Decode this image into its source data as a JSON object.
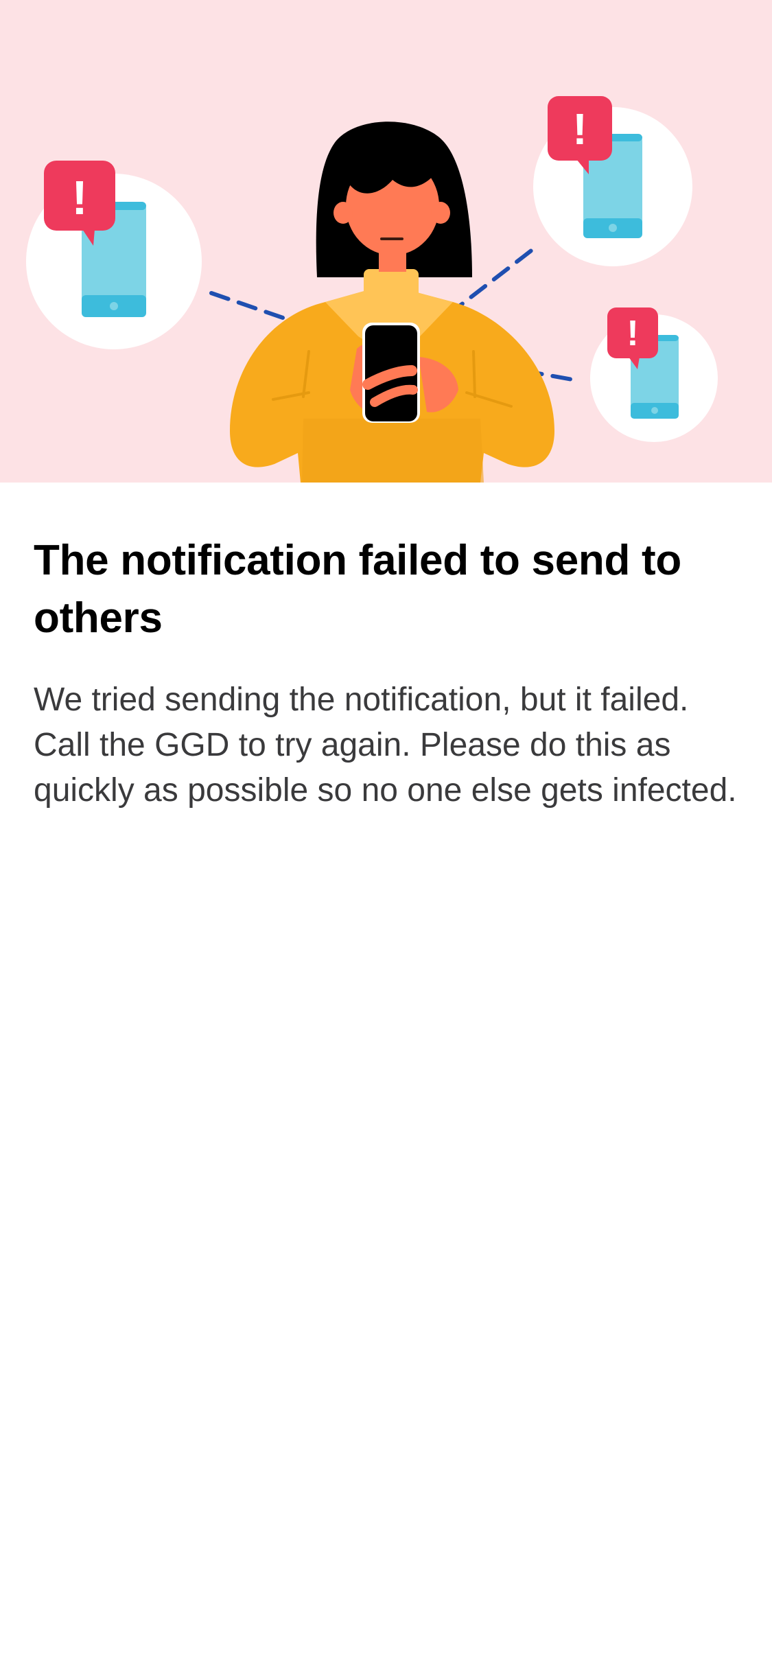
{
  "colors": {
    "hero_background": "#fde2e5",
    "alert_red": "#ee3a5c",
    "phone_blue": "#7dd4e6",
    "dash_blue": "#1f4fb0",
    "sweater_yellow": "#f8aa1c",
    "skin": "#ff7a55",
    "hair": "#000000"
  },
  "illustration": {
    "alert_symbol": "!",
    "icons": [
      "alert-bubble-icon",
      "smartphone-icon",
      "person-holding-phone"
    ]
  },
  "message": {
    "title": "The notification failed to send to others",
    "body": "We tried sending the notification, but it failed. Call the GGD to try again. Please do this as quickly as possible so no one else gets infected."
  }
}
